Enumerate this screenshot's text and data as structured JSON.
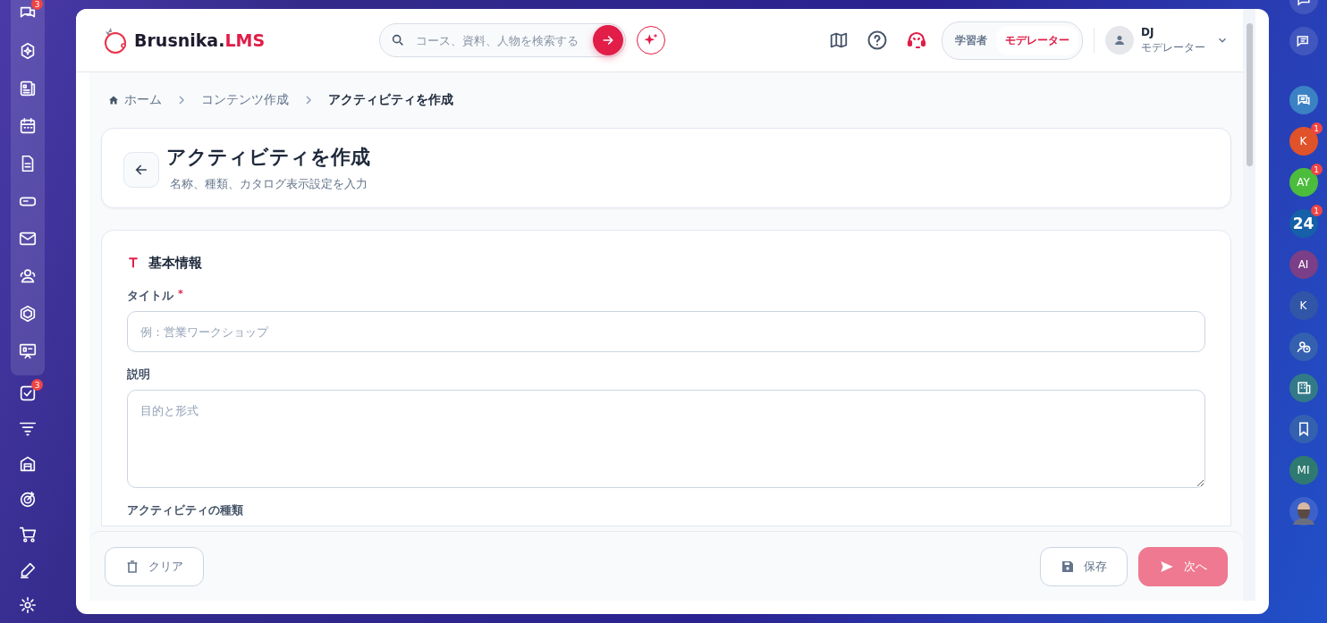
{
  "left_rail": {
    "group_badge": "3",
    "tasks_badge": "3"
  },
  "header": {
    "logo": {
      "name": "Brusnika.",
      "accent": "LMS"
    },
    "search": {
      "placeholder": "コース、資料、人物を検索する"
    },
    "roles": [
      {
        "label": "学習者",
        "selected": false
      },
      {
        "label": "モデレーター",
        "selected": true
      }
    ],
    "user": {
      "name": "DJ",
      "role": "モデレーター"
    }
  },
  "breadcrumb": [
    {
      "label": "ホーム",
      "current": false
    },
    {
      "label": "コンテンツ作成",
      "current": false
    },
    {
      "label": "アクティビティを作成",
      "current": true
    }
  ],
  "page": {
    "title": "アクティビティを作成",
    "subtitle": "名称、種類、カタログ表示設定を入力"
  },
  "section": {
    "title": "基本情報",
    "fields": [
      {
        "kind": "input",
        "label": "タイトル",
        "marker": "*",
        "placeholder": "例：営業ワークショップ"
      },
      {
        "kind": "textarea",
        "label": "説明",
        "placeholder": "目的と形式"
      },
      {
        "kind": "heading",
        "label": "アクティビティの種類"
      }
    ]
  },
  "footer": {
    "clear": {
      "label": "クリア"
    },
    "save": {
      "label": "保存"
    },
    "next": {
      "label": "次へ",
      "disabled": true
    }
  },
  "right_rail": [
    {
      "kind": "icon"
    },
    {
      "kind": "icon"
    },
    {
      "kind": "icon",
      "color": "#3b82c4"
    },
    {
      "kind": "initials",
      "text": "K",
      "color": "#e0522a",
      "badge": "1"
    },
    {
      "kind": "initials",
      "text": "AY",
      "color": "#4cbc3c",
      "badge": "1"
    },
    {
      "kind": "initials",
      "text": "24",
      "color": "#1560a8",
      "badge": "1"
    },
    {
      "kind": "initials",
      "text": "AI",
      "color": "#7a3f86"
    },
    {
      "kind": "initials",
      "text": "K",
      "color": "#3156a8"
    },
    {
      "kind": "icon",
      "color": "#3460b0"
    },
    {
      "kind": "icon",
      "color": "#327a88"
    },
    {
      "kind": "icon",
      "color": "#3460b0"
    },
    {
      "kind": "initials",
      "text": "MI",
      "color": "#2f7a70"
    },
    {
      "kind": "avatar"
    }
  ]
}
